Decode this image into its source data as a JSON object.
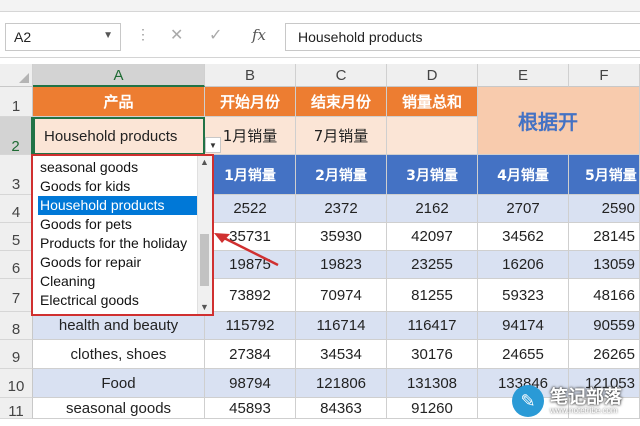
{
  "formula_bar": {
    "name_box": "A2",
    "cancel_icon": "✕",
    "enter_icon": "✓",
    "fx_label": "fx",
    "content": "Household products"
  },
  "columns": [
    "A",
    "B",
    "C",
    "D",
    "E",
    "F"
  ],
  "rows": [
    "1",
    "2",
    "3",
    "4",
    "5",
    "6",
    "7",
    "8",
    "9",
    "10",
    "11"
  ],
  "headers_row1": {
    "A": "产品",
    "B": "开始月份",
    "C": "结束月份",
    "D": "销量总和",
    "E": "根据开"
  },
  "row2": {
    "A": "Household products",
    "B": "1月销量",
    "C": "7月销量",
    "D": ""
  },
  "row3": {
    "B": "1月销量",
    "C": "2月销量",
    "D": "3月销量",
    "E": "4月销量",
    "F": "5月销量"
  },
  "data_rows": [
    {
      "label": "",
      "values": [
        "2522",
        "2372",
        "2162",
        "2707",
        "2590"
      ]
    },
    {
      "label": "",
      "values": [
        "35731",
        "35930",
        "42097",
        "34562",
        "28145"
      ]
    },
    {
      "label": "",
      "values": [
        "19875",
        "19823",
        "23255",
        "16206",
        "13059"
      ]
    },
    {
      "label": "",
      "values": [
        "73892",
        "70974",
        "81255",
        "59323",
        "48166"
      ]
    },
    {
      "label": "health and beauty",
      "values": [
        "115792",
        "116714",
        "116417",
        "94174",
        "90559"
      ]
    },
    {
      "label": "clothes, shoes",
      "values": [
        "27384",
        "34534",
        "30176",
        "24655",
        "26265"
      ]
    },
    {
      "label": "Food",
      "values": [
        "98794",
        "121806",
        "131308",
        "133846",
        "121053"
      ]
    },
    {
      "label": "seasonal goods",
      "values": [
        "45893",
        "84363",
        "91260",
        "",
        ""
      ]
    }
  ],
  "dropdown": {
    "items": [
      "seasonal goods",
      "Goods for kids",
      "Household products",
      "Goods for pets",
      "Products for the holiday",
      "Goods for repair",
      "Cleaning",
      "Electrical goods"
    ],
    "selected_index": 2
  },
  "watermark": {
    "logo_glyph": "✎",
    "text": "笔记部落",
    "url": "www.notetribe.com"
  },
  "colors": {
    "orange_header": "#ed7d31",
    "blue_header": "#4472c4",
    "light_row": "#d9e1f2",
    "peach": "#fbe5d6",
    "selection_green": "#217346",
    "dropdown_highlight": "#0078d7",
    "annotation_red": "#d03030"
  }
}
